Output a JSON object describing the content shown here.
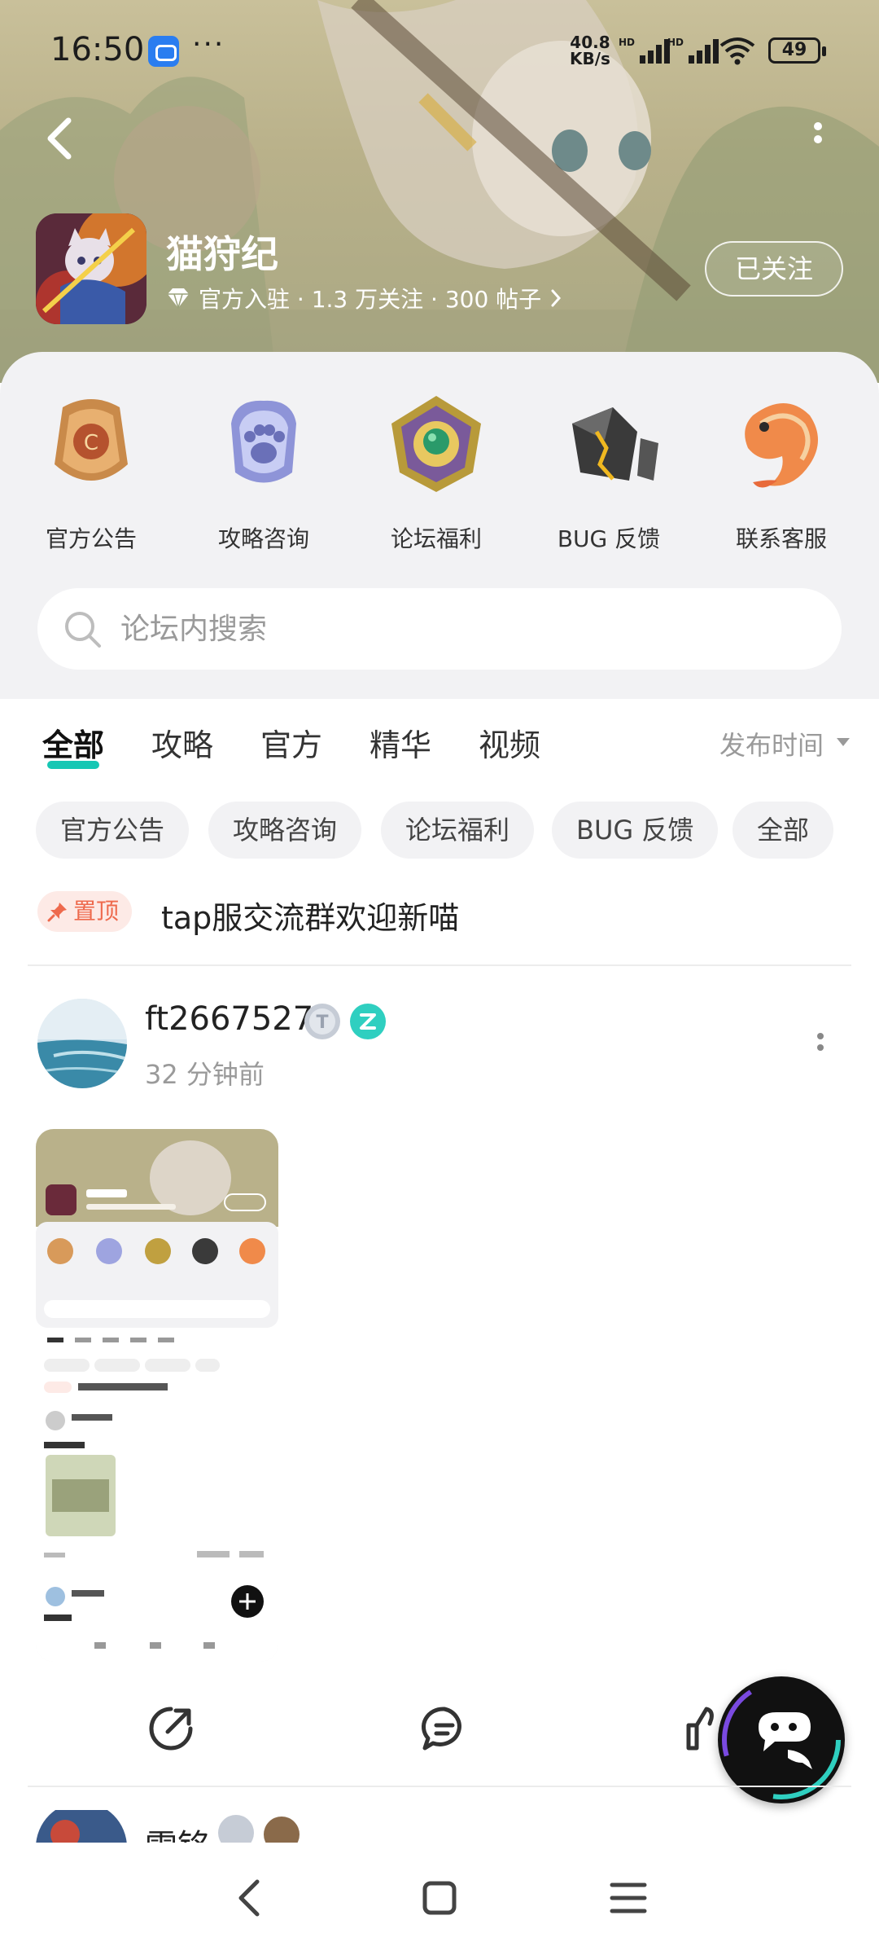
{
  "status_bar": {
    "time": "16:50",
    "more": "···",
    "net_speed_value": "40.8",
    "net_speed_unit": "KB/s",
    "signal_tag": "HD",
    "battery": "49"
  },
  "header": {
    "game_title": "猫狩纪",
    "meta": "官方入驻 · 1.3 万关注 · 300 帖子",
    "follow_label": "已关注"
  },
  "categories": [
    {
      "label": "官方公告",
      "icon": "badge-icon"
    },
    {
      "label": "攻略咨询",
      "icon": "paw-icon"
    },
    {
      "label": "论坛福利",
      "icon": "jade-icon"
    },
    {
      "label": "BUG 反馈",
      "icon": "crystal-icon"
    },
    {
      "label": "联系客服",
      "icon": "koi-icon"
    }
  ],
  "search": {
    "placeholder": "论坛内搜索"
  },
  "tabs": [
    "全部",
    "攻略",
    "官方",
    "精华",
    "视频"
  ],
  "sort_label": "发布时间",
  "chips": [
    "官方公告",
    "攻略咨询",
    "论坛福利",
    "BUG 反馈",
    "全部"
  ],
  "pinned": {
    "badge": "置顶",
    "title": "tap服交流群欢迎新喵"
  },
  "post": {
    "username": "ft2667527",
    "time_ago": "32 分钟前"
  },
  "next_post": {
    "username": "雪铭"
  },
  "colors": {
    "accent": "#16c7b4",
    "pin": "#ee6a4d",
    "muted": "#9a9a9a"
  }
}
